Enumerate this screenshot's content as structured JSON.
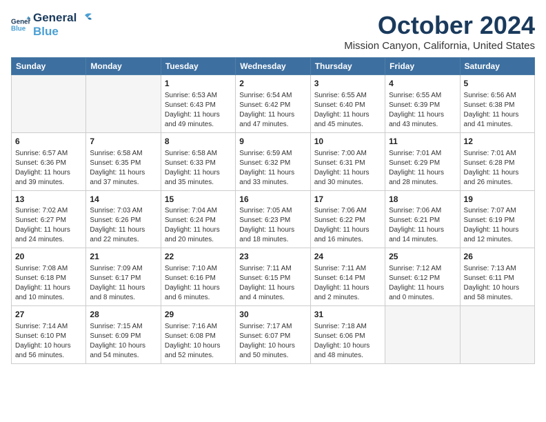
{
  "logo": {
    "line1": "General",
    "line2": "Blue"
  },
  "title": "October 2024",
  "location": "Mission Canyon, California, United States",
  "weekdays": [
    "Sunday",
    "Monday",
    "Tuesday",
    "Wednesday",
    "Thursday",
    "Friday",
    "Saturday"
  ],
  "weeks": [
    [
      {
        "day": "",
        "info": ""
      },
      {
        "day": "",
        "info": ""
      },
      {
        "day": "1",
        "info": "Sunrise: 6:53 AM\nSunset: 6:43 PM\nDaylight: 11 hours and 49 minutes."
      },
      {
        "day": "2",
        "info": "Sunrise: 6:54 AM\nSunset: 6:42 PM\nDaylight: 11 hours and 47 minutes."
      },
      {
        "day": "3",
        "info": "Sunrise: 6:55 AM\nSunset: 6:40 PM\nDaylight: 11 hours and 45 minutes."
      },
      {
        "day": "4",
        "info": "Sunrise: 6:55 AM\nSunset: 6:39 PM\nDaylight: 11 hours and 43 minutes."
      },
      {
        "day": "5",
        "info": "Sunrise: 6:56 AM\nSunset: 6:38 PM\nDaylight: 11 hours and 41 minutes."
      }
    ],
    [
      {
        "day": "6",
        "info": "Sunrise: 6:57 AM\nSunset: 6:36 PM\nDaylight: 11 hours and 39 minutes."
      },
      {
        "day": "7",
        "info": "Sunrise: 6:58 AM\nSunset: 6:35 PM\nDaylight: 11 hours and 37 minutes."
      },
      {
        "day": "8",
        "info": "Sunrise: 6:58 AM\nSunset: 6:33 PM\nDaylight: 11 hours and 35 minutes."
      },
      {
        "day": "9",
        "info": "Sunrise: 6:59 AM\nSunset: 6:32 PM\nDaylight: 11 hours and 33 minutes."
      },
      {
        "day": "10",
        "info": "Sunrise: 7:00 AM\nSunset: 6:31 PM\nDaylight: 11 hours and 30 minutes."
      },
      {
        "day": "11",
        "info": "Sunrise: 7:01 AM\nSunset: 6:29 PM\nDaylight: 11 hours and 28 minutes."
      },
      {
        "day": "12",
        "info": "Sunrise: 7:01 AM\nSunset: 6:28 PM\nDaylight: 11 hours and 26 minutes."
      }
    ],
    [
      {
        "day": "13",
        "info": "Sunrise: 7:02 AM\nSunset: 6:27 PM\nDaylight: 11 hours and 24 minutes."
      },
      {
        "day": "14",
        "info": "Sunrise: 7:03 AM\nSunset: 6:26 PM\nDaylight: 11 hours and 22 minutes."
      },
      {
        "day": "15",
        "info": "Sunrise: 7:04 AM\nSunset: 6:24 PM\nDaylight: 11 hours and 20 minutes."
      },
      {
        "day": "16",
        "info": "Sunrise: 7:05 AM\nSunset: 6:23 PM\nDaylight: 11 hours and 18 minutes."
      },
      {
        "day": "17",
        "info": "Sunrise: 7:06 AM\nSunset: 6:22 PM\nDaylight: 11 hours and 16 minutes."
      },
      {
        "day": "18",
        "info": "Sunrise: 7:06 AM\nSunset: 6:21 PM\nDaylight: 11 hours and 14 minutes."
      },
      {
        "day": "19",
        "info": "Sunrise: 7:07 AM\nSunset: 6:19 PM\nDaylight: 11 hours and 12 minutes."
      }
    ],
    [
      {
        "day": "20",
        "info": "Sunrise: 7:08 AM\nSunset: 6:18 PM\nDaylight: 11 hours and 10 minutes."
      },
      {
        "day": "21",
        "info": "Sunrise: 7:09 AM\nSunset: 6:17 PM\nDaylight: 11 hours and 8 minutes."
      },
      {
        "day": "22",
        "info": "Sunrise: 7:10 AM\nSunset: 6:16 PM\nDaylight: 11 hours and 6 minutes."
      },
      {
        "day": "23",
        "info": "Sunrise: 7:11 AM\nSunset: 6:15 PM\nDaylight: 11 hours and 4 minutes."
      },
      {
        "day": "24",
        "info": "Sunrise: 7:11 AM\nSunset: 6:14 PM\nDaylight: 11 hours and 2 minutes."
      },
      {
        "day": "25",
        "info": "Sunrise: 7:12 AM\nSunset: 6:12 PM\nDaylight: 11 hours and 0 minutes."
      },
      {
        "day": "26",
        "info": "Sunrise: 7:13 AM\nSunset: 6:11 PM\nDaylight: 10 hours and 58 minutes."
      }
    ],
    [
      {
        "day": "27",
        "info": "Sunrise: 7:14 AM\nSunset: 6:10 PM\nDaylight: 10 hours and 56 minutes."
      },
      {
        "day": "28",
        "info": "Sunrise: 7:15 AM\nSunset: 6:09 PM\nDaylight: 10 hours and 54 minutes."
      },
      {
        "day": "29",
        "info": "Sunrise: 7:16 AM\nSunset: 6:08 PM\nDaylight: 10 hours and 52 minutes."
      },
      {
        "day": "30",
        "info": "Sunrise: 7:17 AM\nSunset: 6:07 PM\nDaylight: 10 hours and 50 minutes."
      },
      {
        "day": "31",
        "info": "Sunrise: 7:18 AM\nSunset: 6:06 PM\nDaylight: 10 hours and 48 minutes."
      },
      {
        "day": "",
        "info": ""
      },
      {
        "day": "",
        "info": ""
      }
    ]
  ]
}
